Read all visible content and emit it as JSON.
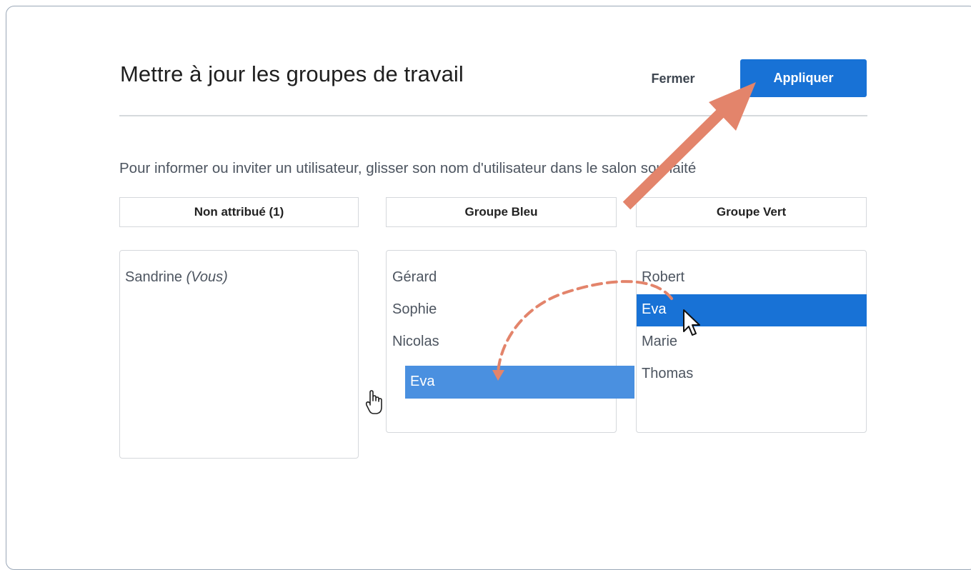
{
  "dialog": {
    "title": "Mettre à jour les groupes de travail",
    "close_label": "Fermer",
    "apply_label": "Appliquer",
    "instruction": "Pour informer ou inviter un utilisateur, glisser son nom d'utilisateur dans le salon souhaité"
  },
  "columns": [
    {
      "header": "Non attribué (1)",
      "members": [
        "Sandrine"
      ],
      "self_suffix": "(Vous)"
    },
    {
      "header": "Groupe Bleu",
      "members": [
        "Gérard",
        "Sophie",
        "Nicolas"
      ]
    },
    {
      "header": "Groupe Vert",
      "members": [
        "Robert",
        "Eva",
        "Marie",
        "Thomas"
      ]
    }
  ],
  "drag": {
    "dragged_item": "Eva",
    "ghost_label": "Eva"
  },
  "colors": {
    "accent": "#1872d6",
    "drag_ghost": "#4a90e0",
    "annotation": "#e3846b"
  },
  "icons": [
    "hand-pointer-icon",
    "arrow-cursor-icon"
  ]
}
